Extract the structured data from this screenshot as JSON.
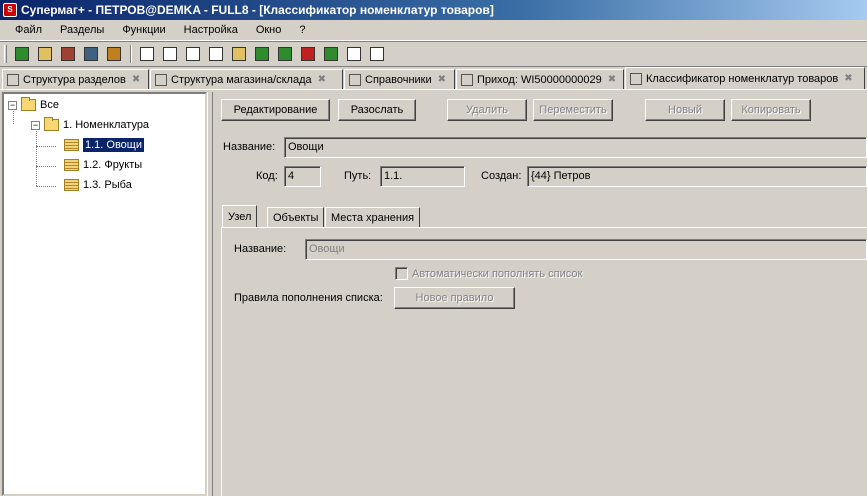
{
  "window": {
    "title": "Супермаг+ - ПЕТРОВ@DEMKA - FULL8  - [Классификатор номенклатур товаров]",
    "icon_label": "S"
  },
  "menu": [
    "Файл",
    "Разделы",
    "Функции",
    "Настройка",
    "Окно",
    "?"
  ],
  "toolbar": {
    "buttons": [
      {
        "name": "green-db-icon",
        "color": "#2e8b2e"
      },
      {
        "name": "face-icon",
        "color": "#e0c060"
      },
      {
        "name": "store-icon",
        "color": "#a04030"
      },
      {
        "name": "cart-icon",
        "color": "#406080"
      },
      {
        "name": "bars-icon",
        "color": "#c08020"
      },
      {
        "name": "doc-arrow-icon",
        "color": "#ffffff"
      },
      {
        "name": "doc-plus-icon",
        "color": "#ffffff"
      },
      {
        "name": "doc-gift-icon",
        "color": "#ffffff"
      },
      {
        "name": "doc-check-icon",
        "color": "#ffffff"
      },
      {
        "name": "folder-gift-icon",
        "color": "#e0c060"
      },
      {
        "name": "folder-star-icon",
        "color": "#2e8b2e"
      },
      {
        "name": "green-tag-icon",
        "color": "#2e8b2e"
      },
      {
        "name": "red-tag-icon",
        "color": "#c02020"
      },
      {
        "name": "truck-icon",
        "color": "#2e8b2e"
      },
      {
        "name": "doc-red-icon",
        "color": "#ffffff"
      },
      {
        "name": "doc-green-icon",
        "color": "#ffffff"
      }
    ]
  },
  "doc_tabs": [
    {
      "label": "Структура разделов",
      "width": 147,
      "active": false
    },
    {
      "label": "Структура магазина/склада",
      "width": 193,
      "active": false
    },
    {
      "label": "Справочники",
      "width": 111,
      "active": false
    },
    {
      "label": "Приход: WI50000000029",
      "width": 168,
      "active": false
    },
    {
      "label": "Классификатор номенклатур товаров",
      "width": 240,
      "active": true
    }
  ],
  "tree": {
    "root": "Все",
    "level1": "1. Номенклатура",
    "items": [
      "1.1. Овощи",
      "1.2. Фрукты",
      "1.3. Рыба"
    ]
  },
  "buttons": {
    "edit": "Редактирование",
    "send": "Разослать",
    "delete": "Удалить",
    "move": "Переместить",
    "new": "Новый",
    "copy": "Копировать"
  },
  "header": {
    "name_label": "Название:",
    "name_value": "Овощи",
    "code_label": "Код:",
    "code_value": "4",
    "path_label": "Путь:",
    "path_value": "1.1.",
    "created_label": "Создан:",
    "created_value": "{44} Петров"
  },
  "inner_tabs": [
    "Узел",
    "Объекты",
    "Места хранения"
  ],
  "node": {
    "name_label": "Название:",
    "name_value": "Овощи",
    "auto_fill_label": "Автоматически пополнять список",
    "rules_label": "Правила пополнения списка:",
    "new_rule_button": "Новое правило"
  }
}
